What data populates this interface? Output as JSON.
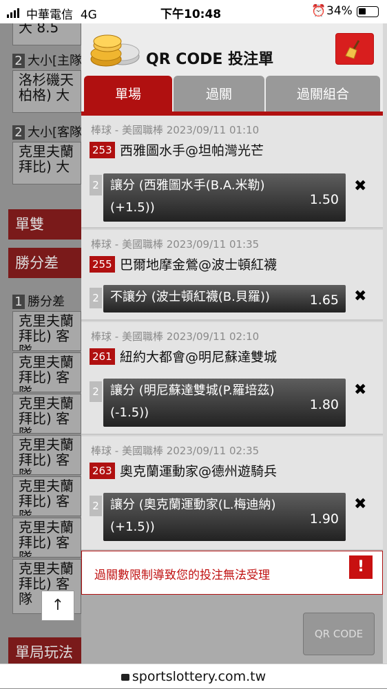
{
  "status_bar": {
    "carrier": "中華電信",
    "network": "4G",
    "time": "下午10:48",
    "battery": "34%"
  },
  "background_page": {
    "cards": [
      "大 8.5",
      "洛杉磯天 柏格) 大",
      "克里夫蘭 拜比) 大"
    ],
    "labels": [
      {
        "num": "2",
        "text": "大小[主隊"
      },
      {
        "num": "2",
        "text": "大小[客隊"
      },
      {
        "num": "1",
        "text": "勝分差"
      }
    ],
    "headers": [
      "單雙",
      "勝分差",
      "單局玩法"
    ],
    "win_rows": [
      "克里夫蘭 拜比) 客隊",
      "克里夫蘭 拜比) 客隊",
      "克里夫蘭 拜比) 客隊",
      "克里夫蘭 拜比) 客隊",
      "克里夫蘭 拜比) 客隊",
      "克里夫蘭 拜比) 客隊",
      "克里夫蘭 拜比) 客隊"
    ],
    "scroll_top": "↑"
  },
  "panel": {
    "title": "QR CODE 投注單",
    "tabs": [
      "單場",
      "過關",
      "過關組合"
    ],
    "bets": [
      {
        "meta": "棒球 - 美國職棒 2023/09/11 01:10",
        "code": "253",
        "match": "西雅圖水手@坦帕灣光芒",
        "num": "2",
        "sel1": "讓分 (西雅圖水手(B.A.米勒)",
        "sel2": "(+1.5))",
        "odds": "1.50"
      },
      {
        "meta": "棒球 - 美國職棒 2023/09/11 01:35",
        "code": "255",
        "match": "巴爾地摩金鶯@波士頓紅襪",
        "num": "2",
        "sel1": "不讓分 (波士頓紅襪(B.貝羅))",
        "sel2": "",
        "odds": "1.65"
      },
      {
        "meta": "棒球 - 美國職棒 2023/09/11 02:10",
        "code": "261",
        "match": "紐約大都會@明尼蘇達雙城",
        "num": "2",
        "sel1": "讓分 (明尼蘇達雙城(P.羅培茲)",
        "sel2": "(-1.5))",
        "odds": "1.80"
      },
      {
        "meta": "棒球 - 美國職棒 2023/09/11 02:35",
        "code": "263",
        "match": "奧克蘭運動家@德州遊騎兵",
        "num": "2",
        "sel1": "讓分 (奧克蘭運動家(L.梅迪納)",
        "sel2": "(+1.5))",
        "odds": "1.90"
      }
    ],
    "warning": "過關數限制導致您的投注無法受理",
    "warning_icon": "!",
    "qr_button": "QR CODE",
    "remove_glyph": "✖"
  },
  "url": "sportslottery.com.tw"
}
